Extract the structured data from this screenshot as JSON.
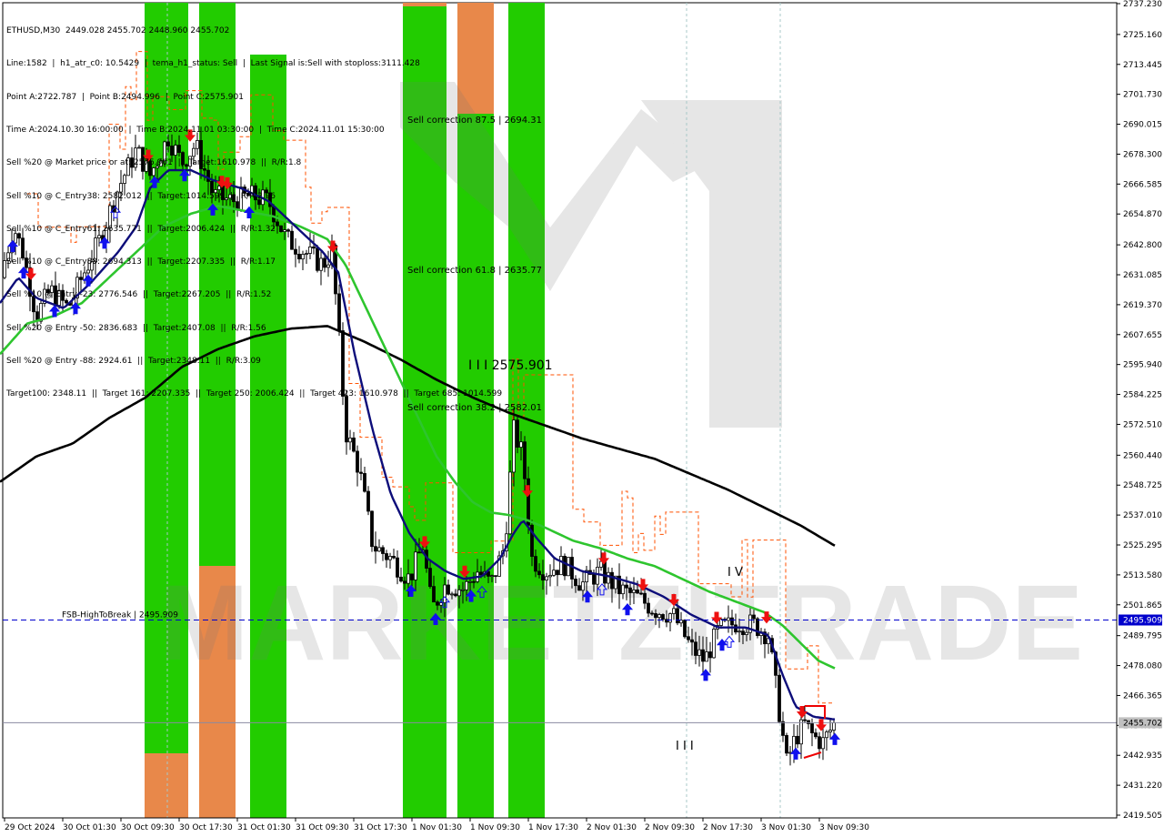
{
  "info": {
    "symbol_line": "ETHUSD,M30  2449.028 2455.702 2448.960 2455.702",
    "lines": [
      "Line:1582  |  h1_atr_c0: 10.5429  |  tema_h1_status: Sell  |  Last Signal is:Sell with stoploss:3111.428",
      "Point A:2722.787  |  Point B:2494.996  |  Point C:2575.901",
      "Time A:2024.10.30 16:00:00  |  Time B:2024.11.01 03:30:00  |  Time C:2024.11.01 15:30:00",
      "Sell %20 @ Market price or at: 2575.901  ||  Target:1610.978  ||  R/R:1.8",
      "Sell %10 @ C_Entry38: 2582.012  ||  Target:1014.599  ||  R/R:2.96",
      "Sell %10 @ C_Entry61: 2635.771  ||  Target:2006.424  ||  R/R:1.32",
      "Sell %10 @ C_Entry88: 2694.313  ||  Target:2207.335  ||  R/R:1.17",
      "Sell %10 @ Entry -23: 2776.546  ||  Target:2267.205  ||  R/R:1.52",
      "Sell %20 @ Entry -50: 2836.683  ||  Target:2407.08  ||  R/R:1.56",
      "Sell %20 @ Entry -88: 2924.61  ||  Target:2348.11  ||  R/R:3.09",
      "Target100: 2348.11  ||  Target 161: 2207.335  ||  Target 250: 2006.424  ||  Target 423: 1610.978  ||  Target 685: 1014.599"
    ]
  },
  "y_axis": {
    "labels": [
      "2737.230",
      "2725.160",
      "2713.445",
      "2701.730",
      "2690.015",
      "2678.300",
      "2666.585",
      "2654.870",
      "2642.800",
      "2631.085",
      "2619.370",
      "2607.655",
      "2595.940",
      "2584.225",
      "2572.510",
      "2560.440",
      "2548.725",
      "2537.010",
      "2525.295",
      "2513.580",
      "2501.865",
      "2489.795",
      "2478.080",
      "2466.365",
      "2454.650",
      "2442.935",
      "2431.220",
      "2419.505"
    ],
    "current_price": "2455.702",
    "fsb_price": "2495.909"
  },
  "x_axis": {
    "labels": [
      "29 Oct 2024",
      "30 Oct 01:30",
      "30 Oct 09:30",
      "30 Oct 17:30",
      "31 Oct 01:30",
      "31 Oct 09:30",
      "31 Oct 17:30",
      "1 Nov 01:30",
      "1 Nov 09:30",
      "1 Nov 17:30",
      "2 Nov 01:30",
      "2 Nov 09:30",
      "2 Nov 17:30",
      "3 Nov 01:30",
      "3 Nov 09:30"
    ]
  },
  "annotations": {
    "sell_correction_875": "Sell correction 87.5 | 2694.31",
    "sell_correction_618": "Sell correction 61.8 | 2635.77",
    "sell_correction_382": "Sell correction 38.2 | 2582.01",
    "point_c_label": "I I I  2575.901",
    "wave_iv": "I V",
    "wave_iii": "I I I",
    "fsb_label": "FSB-HighToBreak | 2495.909",
    "watermark": "MARKETZITRADE"
  },
  "colors": {
    "bright_green": "#22cc00",
    "orange": "#e8884a",
    "ma_navy": "#0d0d7a",
    "ma_green": "#2ec52e",
    "ma_black": "#000000",
    "fsb_blue": "#0000cc",
    "up_arrow": "#1010ee",
    "down_arrow": "#ee1010",
    "stop_line": "#ff5000"
  },
  "chart_data": {
    "type": "candlestick",
    "symbol": "ETHUSD",
    "timeframe": "M30",
    "ylim": [
      2419.505,
      2737.23
    ],
    "current_price": 2455.702,
    "fsb_level": 2495.909,
    "point_a": 2722.787,
    "point_b": 2494.996,
    "point_c": 2575.901,
    "close_path_keypoints": [
      [
        0,
        2630
      ],
      [
        15,
        2650
      ],
      [
        25,
        2640
      ],
      [
        40,
        2615
      ],
      [
        55,
        2625
      ],
      [
        75,
        2618
      ],
      [
        90,
        2630
      ],
      [
        110,
        2645
      ],
      [
        130,
        2665
      ],
      [
        150,
        2680
      ],
      [
        165,
        2670
      ],
      [
        185,
        2685
      ],
      [
        200,
        2675
      ],
      [
        215,
        2682
      ],
      [
        235,
        2662
      ],
      [
        255,
        2660
      ],
      [
        275,
        2662
      ],
      [
        295,
        2660
      ],
      [
        315,
        2645
      ],
      [
        335,
        2640
      ],
      [
        355,
        2635
      ],
      [
        365,
        2640
      ],
      [
        372,
        2610
      ],
      [
        380,
        2570
      ],
      [
        395,
        2555
      ],
      [
        410,
        2525
      ],
      [
        430,
        2520
      ],
      [
        450,
        2512
      ],
      [
        465,
        2525
      ],
      [
        475,
        2500
      ],
      [
        490,
        2510
      ],
      [
        510,
        2508
      ],
      [
        525,
        2515
      ],
      [
        540,
        2510
      ],
      [
        555,
        2525
      ],
      [
        565,
        2570
      ],
      [
        575,
        2560
      ],
      [
        585,
        2520
      ],
      [
        600,
        2515
      ],
      [
        620,
        2518
      ],
      [
        640,
        2510
      ],
      [
        660,
        2515
      ],
      [
        680,
        2508
      ],
      [
        700,
        2505
      ],
      [
        720,
        2500
      ],
      [
        740,
        2498
      ],
      [
        760,
        2485
      ],
      [
        775,
        2480
      ],
      [
        790,
        2492
      ],
      [
        810,
        2495
      ],
      [
        830,
        2494
      ],
      [
        845,
        2490
      ],
      [
        855,
        2465
      ],
      [
        865,
        2440
      ],
      [
        875,
        2450
      ],
      [
        885,
        2455
      ],
      [
        895,
        2450
      ],
      [
        905,
        2448
      ],
      [
        918,
        2455.702
      ]
    ],
    "ma_fast_keypoints": [
      [
        0,
        2620
      ],
      [
        20,
        2630
      ],
      [
        40,
        2622
      ],
      [
        70,
        2618
      ],
      [
        100,
        2628
      ],
      [
        130,
        2640
      ],
      [
        150,
        2650
      ],
      [
        165,
        2665
      ],
      [
        185,
        2672
      ],
      [
        210,
        2672
      ],
      [
        235,
        2668
      ],
      [
        265,
        2665
      ],
      [
        295,
        2660
      ],
      [
        325,
        2650
      ],
      [
        355,
        2640
      ],
      [
        372,
        2632
      ],
      [
        390,
        2600
      ],
      [
        410,
        2570
      ],
      [
        430,
        2545
      ],
      [
        450,
        2530
      ],
      [
        470,
        2520
      ],
      [
        490,
        2515
      ],
      [
        510,
        2512
      ],
      [
        530,
        2513
      ],
      [
        550,
        2520
      ],
      [
        565,
        2530
      ],
      [
        575,
        2535
      ],
      [
        590,
        2528
      ],
      [
        610,
        2520
      ],
      [
        640,
        2515
      ],
      [
        670,
        2513
      ],
      [
        700,
        2510
      ],
      [
        730,
        2505
      ],
      [
        760,
        2498
      ],
      [
        790,
        2493
      ],
      [
        820,
        2493
      ],
      [
        845,
        2490
      ],
      [
        860,
        2475
      ],
      [
        875,
        2462
      ],
      [
        895,
        2458
      ],
      [
        918,
        2457
      ]
    ],
    "ma_mid_keypoints": [
      [
        0,
        2600
      ],
      [
        30,
        2612
      ],
      [
        60,
        2615
      ],
      [
        90,
        2620
      ],
      [
        120,
        2630
      ],
      [
        150,
        2640
      ],
      [
        180,
        2650
      ],
      [
        210,
        2655
      ],
      [
        240,
        2658
      ],
      [
        270,
        2656
      ],
      [
        300,
        2654
      ],
      [
        330,
        2650
      ],
      [
        360,
        2645
      ],
      [
        380,
        2635
      ],
      [
        400,
        2620
      ],
      [
        420,
        2605
      ],
      [
        440,
        2590
      ],
      [
        460,
        2575
      ],
      [
        480,
        2560
      ],
      [
        500,
        2550
      ],
      [
        520,
        2542
      ],
      [
        540,
        2538
      ],
      [
        560,
        2537
      ],
      [
        580,
        2535
      ],
      [
        600,
        2532
      ],
      [
        630,
        2527
      ],
      [
        660,
        2524
      ],
      [
        690,
        2520
      ],
      [
        720,
        2517
      ],
      [
        750,
        2512
      ],
      [
        780,
        2507
      ],
      [
        810,
        2503
      ],
      [
        840,
        2499
      ],
      [
        860,
        2494
      ],
      [
        880,
        2487
      ],
      [
        900,
        2480
      ],
      [
        918,
        2477
      ]
    ],
    "ma_slow_keypoints": [
      [
        0,
        2550
      ],
      [
        40,
        2560
      ],
      [
        80,
        2565
      ],
      [
        120,
        2575
      ],
      [
        160,
        2583
      ],
      [
        200,
        2595
      ],
      [
        240,
        2602
      ],
      [
        280,
        2607
      ],
      [
        320,
        2610
      ],
      [
        360,
        2611
      ],
      [
        400,
        2605
      ],
      [
        440,
        2598
      ],
      [
        480,
        2590
      ],
      [
        520,
        2583
      ],
      [
        560,
        2577
      ],
      [
        600,
        2572
      ],
      [
        640,
        2567
      ],
      [
        680,
        2563
      ],
      [
        720,
        2559
      ],
      [
        760,
        2553
      ],
      [
        800,
        2547
      ],
      [
        840,
        2540
      ],
      [
        880,
        2533
      ],
      [
        918,
        2525
      ]
    ]
  }
}
